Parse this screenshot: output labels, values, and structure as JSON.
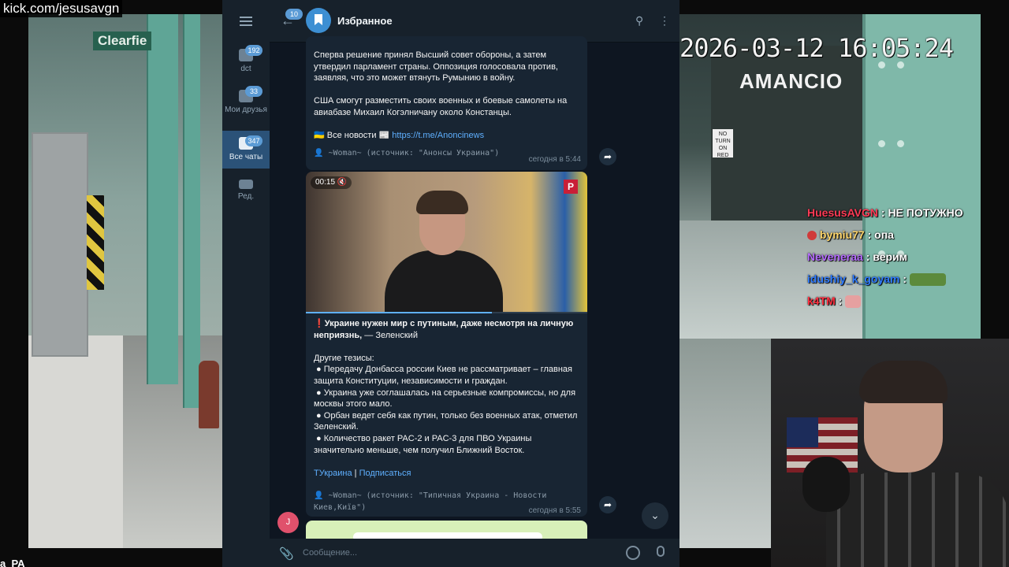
{
  "stream": {
    "url": "kick.com/jesusavgn",
    "timestamp": "2026-03-12 16:05:24",
    "left_sign": "Clearfie",
    "store_name": "AMANCIO",
    "no_turn": "NO TURN ON RED",
    "bottom_text": "a_PA"
  },
  "chat_overlay": [
    {
      "user": "HuesusAVGN",
      "sep": " : ",
      "message": "НЕ ПОТУЖНО",
      "color": "#ff3b56"
    },
    {
      "user": "bymiu77",
      "sep": " : ",
      "message": "опа",
      "color": "#ffd66b"
    },
    {
      "user": "Neveneraa",
      "sep": " : ",
      "message": "верим",
      "color": "#b56cff"
    },
    {
      "user": "idushiy_k_goyam",
      "sep": " : ",
      "message": "",
      "color": "#2f7bff"
    },
    {
      "user": "k4TM",
      "sep": " : ",
      "message": "",
      "color": "#ff3040"
    }
  ],
  "telegram": {
    "sidebar": [
      {
        "label": "dct",
        "badge": "192"
      },
      {
        "label": "Мои друзья",
        "badge": "33"
      },
      {
        "label": "Все чаты",
        "badge": "347"
      },
      {
        "label": "Ред.",
        "badge": ""
      }
    ],
    "header": {
      "back_badge": "10",
      "title": "Избранное"
    },
    "message1": {
      "paragraphs": [
        "Сперва решение принял Высший совет обороны, а затем утвердил парламент страны. Оппозиция голосовала против, заявляя, что это может втянуть Румынию в войну.",
        "США смогут разместить своих военных и боевые самолеты на авиабазе Михаил Когэлничану около Констанцы."
      ],
      "news_prefix": "🇺🇦 Все новости 📰",
      "news_link": "https://t.me/Anoncinews",
      "source": "👤 ~Woman~ (источник: \"Анонсы Украина\")",
      "time": "сегодня в 5:44"
    },
    "message2": {
      "video_time": "00:15",
      "video_progress": 0.66,
      "headline_bold": "❗Украине нужен мир с путиным, даже несмотря на личную неприязнь,",
      "headline_rest": " — Зеленский",
      "subhead": "Другие тезисы:",
      "bullets": [
        "Передачу Донбасса россии Киев не рассматривает – главная защита Конституции, независимости и граждан.",
        "Украина уже соглашалась на серьезные компромиссы, но для москвы этого мало.",
        "Орбан ведет себя как путин, только без военных атак, отметил Зеленский.",
        "Количество ракет PAC-2 и PAC-3 для ПВО Украины значительно меньше, чем получил Ближний Восток."
      ],
      "link1": "ТУкраина",
      "divider": " | ",
      "link2": "Подписаться",
      "source": "👤 ~Woman~ (источник: \"Типичная Украина - Новости Киев,Київ\")",
      "time": "сегодня в 5:55"
    },
    "avatar_letter": "J",
    "composer_placeholder": "Сообщение..."
  }
}
